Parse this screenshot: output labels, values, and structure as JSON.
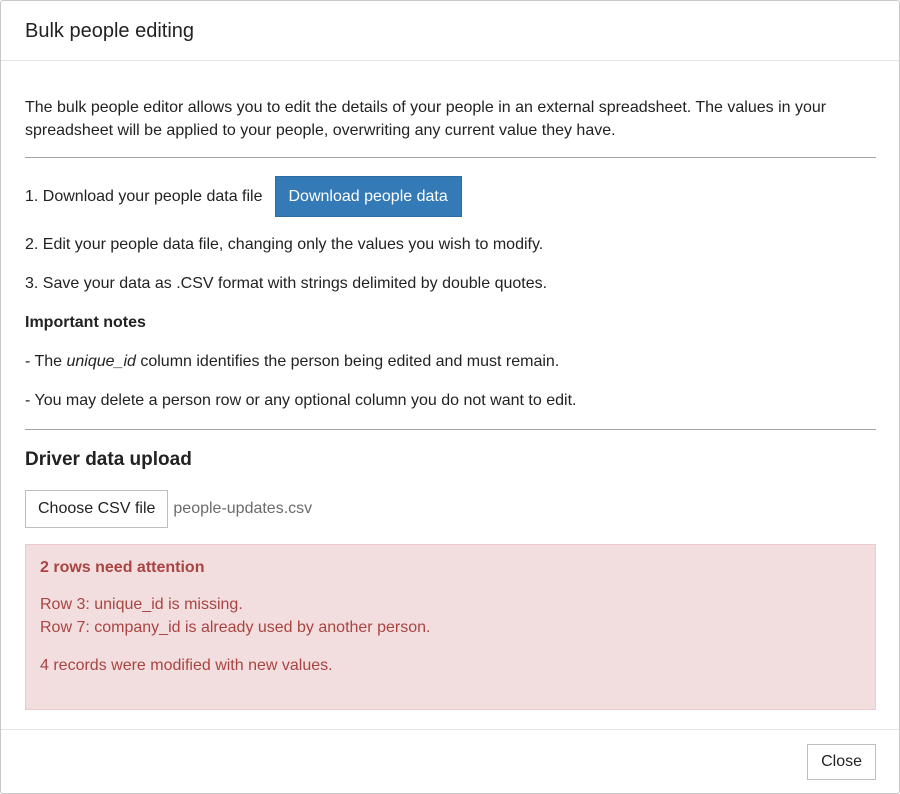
{
  "dialog": {
    "title": "Bulk people editing"
  },
  "intro": {
    "text": "The bulk people editor allows you to edit the details of your people in an external spreadsheet. The values in your spreadsheet will be applied to your people, overwriting any current value they have."
  },
  "steps": {
    "step1_text": "1. Download your people data file",
    "download_button": "Download people data",
    "step2_text": "2. Edit your people data file, changing only the values you wish to modify.",
    "step3_text": "3. Save your data as .CSV format with strings delimited by double quotes."
  },
  "notes": {
    "heading": "Important notes",
    "note1_prefix": "- The ",
    "note1_emphasis": "unique_id",
    "note1_suffix": " column identifies the person being edited and must remain.",
    "note2": "- You may delete a person row or any optional column you do not want to edit."
  },
  "upload": {
    "heading": "Driver data upload",
    "choose_button": "Choose CSV file",
    "file_name": "people-updates.csv"
  },
  "alert": {
    "title": "2 rows need attention",
    "errors": [
      "Row 3: unique_id is missing.",
      "Row 7: company_id is already used by another person."
    ],
    "summary": "4 records were modified with new values.",
    "colors": {
      "background": "#f2dede",
      "text": "#a94442"
    }
  },
  "footer": {
    "close_button": "Close"
  },
  "theme": {
    "primary": "#337ab7"
  }
}
